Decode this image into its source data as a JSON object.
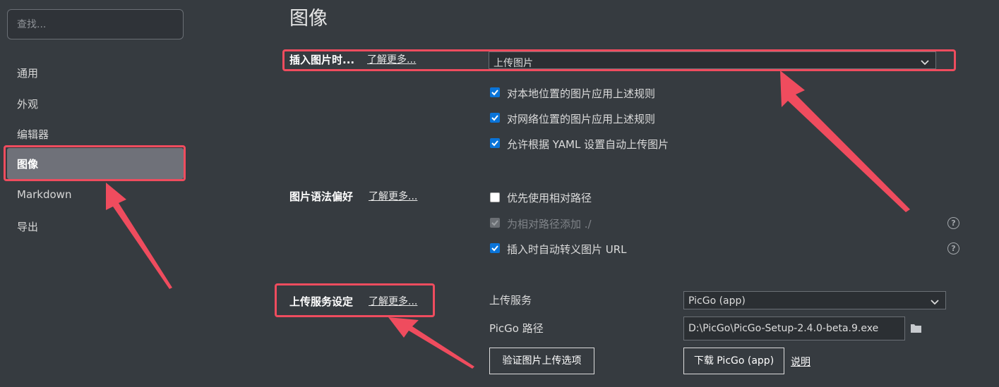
{
  "search": {
    "placeholder": "查找..."
  },
  "sidebar": {
    "items": [
      {
        "label": "通用"
      },
      {
        "label": "外观"
      },
      {
        "label": "编辑器"
      },
      {
        "label": "图像",
        "active": true
      },
      {
        "label": "Markdown"
      },
      {
        "label": "导出"
      }
    ]
  },
  "page": {
    "title": "图像"
  },
  "insert_image": {
    "label": "插入图片时...",
    "learn_more": "了解更多...",
    "selected": "上传图片",
    "options": [
      {
        "label": "对本地位置的图片应用上述规则",
        "checked": true
      },
      {
        "label": "对网络位置的图片应用上述规则",
        "checked": true
      },
      {
        "label": "允许根据 YAML 设置自动上传图片",
        "checked": true
      }
    ]
  },
  "syntax_pref": {
    "label": "图片语法偏好",
    "learn_more": "了解更多...",
    "options": [
      {
        "label": "优先使用相对路径",
        "checked": false
      },
      {
        "label": "为相对路径添加 ./",
        "checked": true,
        "disabled": true
      },
      {
        "label": "插入时自动转义图片 URL",
        "checked": true
      }
    ],
    "help_symbol": "?"
  },
  "upload_service": {
    "label": "上传服务设定",
    "learn_more": "了解更多...",
    "service_label": "上传服务",
    "service_value": "PicGo (app)",
    "path_label": "PicGo 路径",
    "path_value": "D:\\PicGo\\PicGo-Setup-2.4.0-beta.9.exe",
    "verify_button": "验证图片上传选项",
    "download_button": "下载 PicGo (app)",
    "explain_link": "说明"
  },
  "colors": {
    "background": "#363b40",
    "active_item": "#6f7179",
    "checkbox": "#0a74d9",
    "highlight": "#ef4c5e"
  }
}
